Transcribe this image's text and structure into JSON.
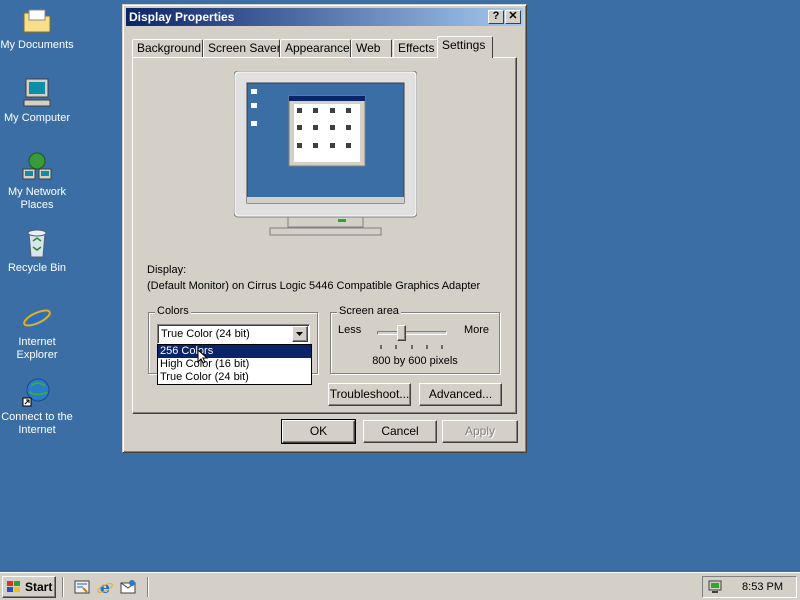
{
  "desktop": {
    "icons": [
      {
        "label": "My Documents"
      },
      {
        "label": "My Computer"
      },
      {
        "label": "My Network Places"
      },
      {
        "label": "Recycle Bin"
      },
      {
        "label": "Internet Explorer"
      },
      {
        "label": "Connect to the Internet"
      }
    ]
  },
  "window": {
    "title": "Display Properties",
    "help_glyph": "?",
    "close_glyph": "✕",
    "tabs": [
      "Background",
      "Screen Saver",
      "Appearance",
      "Web",
      "Effects",
      "Settings"
    ],
    "active_tab": "Settings",
    "display_label": "Display:",
    "display_value": "(Default Monitor) on Cirrus Logic 5446 Compatible Graphics Adapter",
    "colors": {
      "group_title": "Colors",
      "selected": "True Color (24 bit)",
      "options": [
        "256 Colors",
        "High Color (16 bit)",
        "True Color (24 bit)"
      ],
      "highlighted": "256 Colors"
    },
    "screen_area": {
      "group_title": "Screen area",
      "less_label": "Less",
      "more_label": "More",
      "value_text": "800 by 600 pixels",
      "slider_fraction": 0.33
    },
    "buttons": {
      "troubleshoot": "Troubleshoot...",
      "advanced": "Advanced...",
      "ok": "OK",
      "cancel": "Cancel",
      "apply": "Apply"
    }
  },
  "taskbar": {
    "start_label": "Start",
    "clock": "8:53 PM"
  },
  "colors": {
    "desktop_bg": "#3a6ea5",
    "title_active": "#0a246a",
    "selection": "#0a246a"
  }
}
